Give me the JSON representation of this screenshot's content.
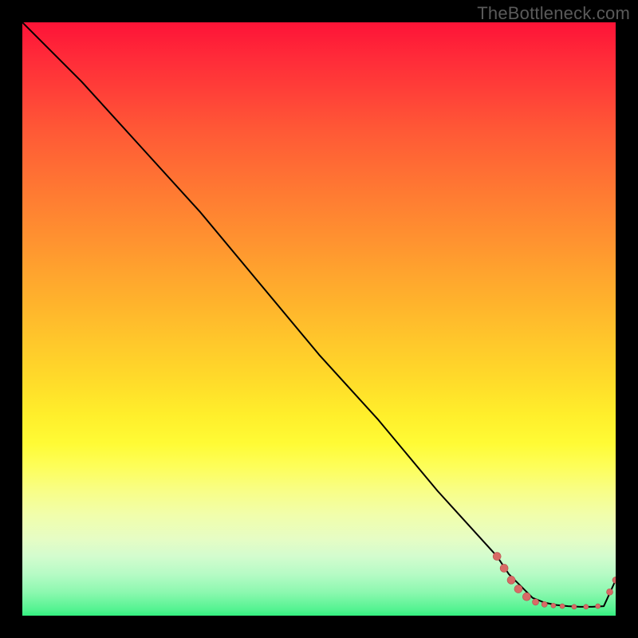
{
  "watermark": "TheBottleneck.com",
  "colors": {
    "line": "#000000",
    "marker_fill": "#d86a66",
    "marker_stroke": "#b54f4b"
  },
  "chart_data": {
    "type": "line",
    "title": "",
    "xlabel": "",
    "ylabel": "",
    "xlim": [
      0,
      100
    ],
    "ylim": [
      0,
      100
    ],
    "series": [
      {
        "name": "curve",
        "x": [
          0,
          10,
          20,
          30,
          40,
          50,
          60,
          70,
          80,
          82,
          84,
          86,
          88,
          90,
          92,
          94,
          96,
          98,
          100
        ],
        "y": [
          100,
          90,
          79,
          68,
          56,
          44,
          33,
          21,
          10,
          7,
          5,
          3,
          2.2,
          1.8,
          1.6,
          1.5,
          1.5,
          1.6,
          6
        ]
      }
    ],
    "markers": [
      {
        "x": 80.0,
        "y": 10.0,
        "r": 5
      },
      {
        "x": 81.2,
        "y": 8.0,
        "r": 5
      },
      {
        "x": 82.4,
        "y": 6.0,
        "r": 5
      },
      {
        "x": 83.6,
        "y": 4.5,
        "r": 5
      },
      {
        "x": 85.0,
        "y": 3.2,
        "r": 5
      },
      {
        "x": 86.5,
        "y": 2.3,
        "r": 4
      },
      {
        "x": 88.0,
        "y": 1.9,
        "r": 3.5
      },
      {
        "x": 89.5,
        "y": 1.7,
        "r": 3
      },
      {
        "x": 91.0,
        "y": 1.6,
        "r": 3
      },
      {
        "x": 93.0,
        "y": 1.5,
        "r": 3
      },
      {
        "x": 95.0,
        "y": 1.5,
        "r": 3
      },
      {
        "x": 97.0,
        "y": 1.6,
        "r": 3
      },
      {
        "x": 99.0,
        "y": 4.0,
        "r": 4
      },
      {
        "x": 100.0,
        "y": 6.0,
        "r": 4
      }
    ]
  }
}
